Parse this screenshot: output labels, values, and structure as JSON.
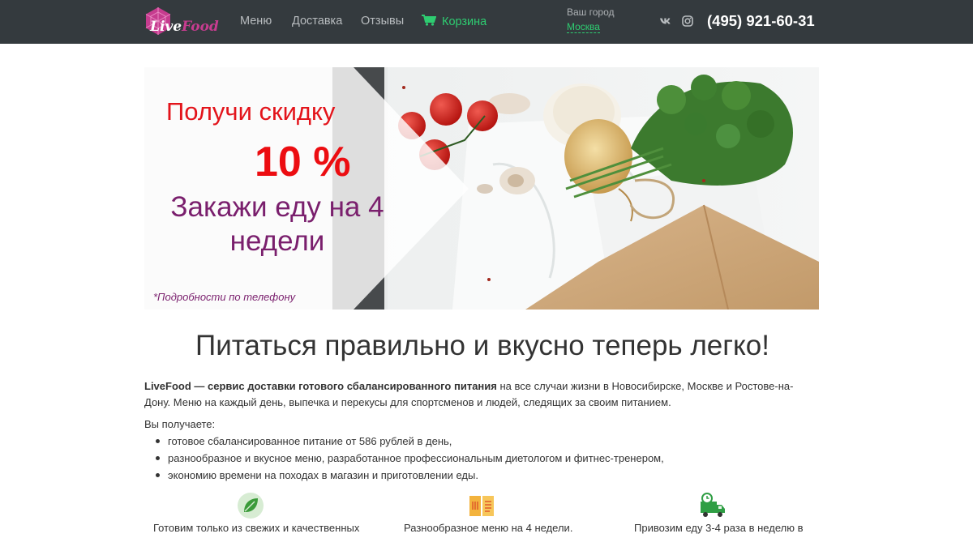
{
  "header": {
    "logo": {
      "text_live": "Live",
      "text_food": "Food"
    },
    "nav": [
      {
        "label": "Меню"
      },
      {
        "label": "Доставка"
      },
      {
        "label": "Отзывы"
      },
      {
        "label": "Корзина",
        "icon": "cart-icon"
      }
    ],
    "city": {
      "label": "Ваш город",
      "value": "Москва"
    },
    "social": [
      {
        "icon": "vk-icon"
      },
      {
        "icon": "instagram-icon"
      }
    ],
    "phone": "(495) 921-60-31"
  },
  "banner": {
    "line1": "Получи скидку",
    "line2": "10 %",
    "line3": "Закажи еду на 4 недели",
    "note": "*Подробности по телефону"
  },
  "main": {
    "title": "Питаться правильно и вкусно теперь легко!",
    "intro_bold": "LiveFood — сервис доставки готового сбалансированного питания",
    "intro_rest": " на все случаи жизни в Новосибирске, Москве и Ростове-на-Дону. Меню на каждый день, выпечка и перекусы для спортсменов и людей, следящих за своим питанием.",
    "get_label": "Вы получаете:",
    "benefits": [
      "готовое сбалансированное питание от 586 рублей в день,",
      "разнообразное и вкусное меню, разработанное профессиональным диетологом и фитнес-тренером,",
      "экономию времени на походах в магазин и приготовлении еды."
    ],
    "features": [
      {
        "icon": "leaf-icon",
        "text": "Готовим только из свежих и качественных"
      },
      {
        "icon": "menu-book-icon",
        "text": "Разнообразное меню на 4 недели."
      },
      {
        "icon": "delivery-truck-icon",
        "text": "Привозим еду 3-4 раза в неделю в"
      }
    ]
  },
  "colors": {
    "navbar_bg": "#343a3e",
    "accent_green": "#2ecc71",
    "promo_red": "#e3141b",
    "promo_purple": "#7a1f6d",
    "brand_pink": "#c63c8f"
  }
}
